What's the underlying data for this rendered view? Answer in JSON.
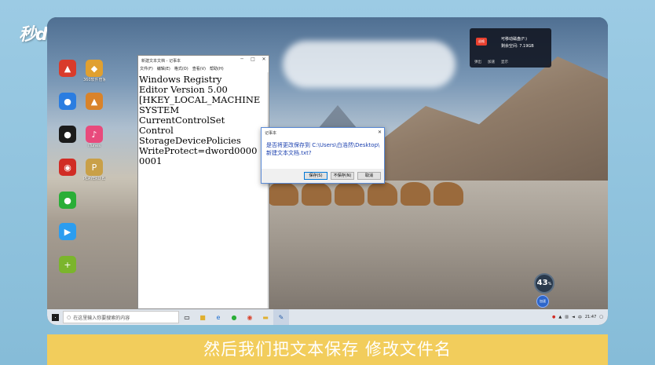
{
  "watermark": "秒dong视频",
  "desktop_icons": [
    {
      "label": "",
      "color": "#d93b2b",
      "glyph": "▲"
    },
    {
      "label": "360软件管家",
      "color": "#e0a030",
      "glyph": "◆"
    },
    {
      "label": "",
      "color": "#2a7de1",
      "glyph": "●"
    },
    {
      "label": "",
      "color": "#d9832a",
      "glyph": "▲"
    },
    {
      "label": "",
      "color": "#1b1b1b",
      "glyph": "●"
    },
    {
      "label": "iTunes",
      "color": "#e84a7c",
      "glyph": "♪"
    },
    {
      "label": "",
      "color": "#d12c24",
      "glyph": "◉"
    },
    {
      "label": "PLAYERU BATTLEGR...",
      "color": "#c9a048",
      "glyph": "P"
    },
    {
      "label": "",
      "color": "#2aae37",
      "glyph": "●"
    },
    {
      "label": "",
      "color": "#2b9df0",
      "glyph": "▶"
    },
    {
      "label": "",
      "color": "#7bb52c",
      "glyph": "+"
    }
  ],
  "notepad": {
    "title": "新建文本文档 - 记事本",
    "menu": [
      "文件(F)",
      "编辑(E)",
      "格式(O)",
      "查看(V)",
      "帮助(H)"
    ],
    "lines": [
      "Windows Registry",
      "Editor Version 5.00",
      "[HKEY_LOCAL_MACHINE",
      "SYSTEM",
      "CurrentControlSet",
      "Control",
      "StorageDevicePolicies",
      "WriteProtect=dword0000",
      "0001"
    ]
  },
  "dialog": {
    "title": "记事本",
    "message_line1": "是否将更改保存到 C:\\Users\\白浩然\\Desktop\\",
    "message_line2": "新建文本文档.txt?",
    "buttons": {
      "save": "保存(S)",
      "dont_save": "不保存(N)",
      "cancel": "取消"
    }
  },
  "disk_popup": {
    "badge": "退格",
    "line1": "可移动磁盘(F:)",
    "line2": "剩余空间: 7.19GB",
    "bottom": [
      "弹出",
      "加速",
      "显示"
    ]
  },
  "speed_widget": {
    "value": "43",
    "unit": "%"
  },
  "boost_label": "加速",
  "taskbar": {
    "search_placeholder": "在这里输入你要搜索的内容",
    "time": "21:47"
  },
  "caption": "然后我们把文本保存 修改文件名",
  "colors": {
    "caption_bg": "#f2cd5c",
    "dialog_text": "#1a3fae"
  }
}
